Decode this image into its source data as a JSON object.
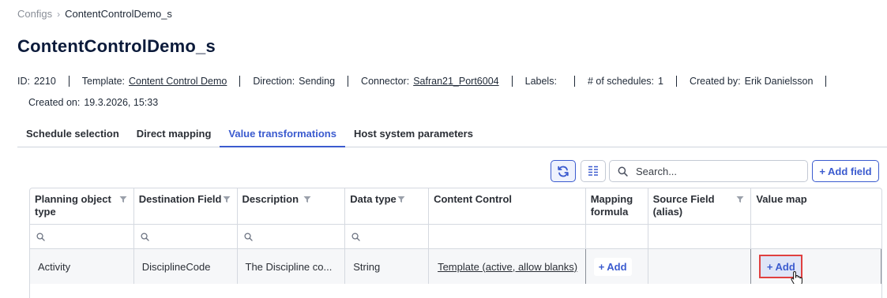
{
  "breadcrumb": {
    "parent": "Configs",
    "current": "ContentControlDemo_s"
  },
  "page": {
    "title": "ContentControlDemo_s"
  },
  "meta": {
    "id_label": "ID:",
    "id_value": "2210",
    "template_label": "Template:",
    "template_value": "Content Control Demo",
    "direction_label": "Direction:",
    "direction_value": "Sending",
    "connector_label": "Connector:",
    "connector_value": "Safran21_Port6004",
    "labels_label": "Labels:",
    "schedules_label": "# of schedules:",
    "schedules_value": "1",
    "created_by_label": "Created by:",
    "created_by_value": "Erik Danielsson",
    "created_on_label": "Created on:",
    "created_on_value": "19.3.2026, 15:33"
  },
  "tabs": [
    {
      "label": "Schedule selection",
      "active": false
    },
    {
      "label": "Direct mapping",
      "active": false
    },
    {
      "label": "Value transformations",
      "active": true
    },
    {
      "label": "Host system parameters",
      "active": false
    }
  ],
  "toolbar": {
    "search_placeholder": "Search...",
    "add_field_label": "Add field",
    "refresh_icon": "refresh-icon",
    "columns_icon": "column-chooser-icon"
  },
  "grid": {
    "columns": [
      {
        "label": "Planning object type",
        "filter": true
      },
      {
        "label": "Destination Field",
        "filter": true
      },
      {
        "label": "Description",
        "filter": true
      },
      {
        "label": "Data type",
        "filter": true
      },
      {
        "label": "Content Control",
        "filter": false
      },
      {
        "label": "Mapping formula",
        "filter": false
      },
      {
        "label": "Source Field (alias)",
        "filter": true
      },
      {
        "label": "Value map",
        "filter": false
      }
    ],
    "rows": [
      {
        "planning_object_type": "Activity",
        "destination_field": "DisciplineCode",
        "description": "The Discipline co...",
        "data_type": "String",
        "content_control": "Template (active, allow blanks)",
        "mapping_formula_action": "Add",
        "source_field": "",
        "value_map_action": "Add"
      }
    ]
  },
  "colors": {
    "accent": "#3b5bcf",
    "highlight_border": "#e04040"
  }
}
